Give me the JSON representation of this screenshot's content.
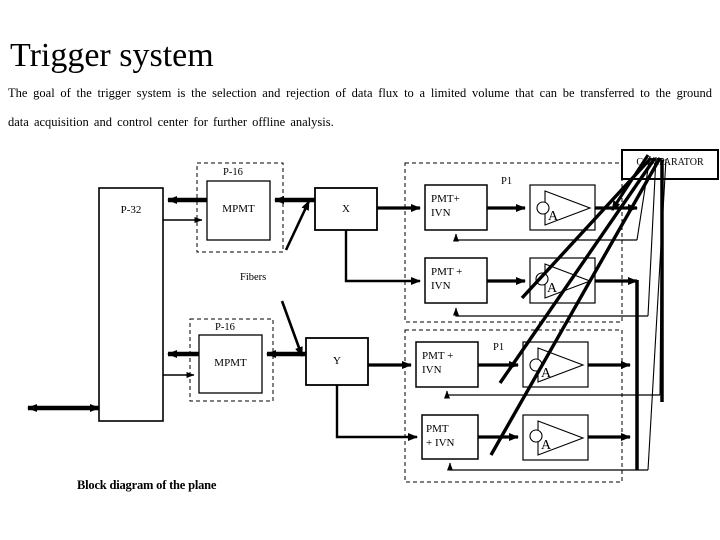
{
  "page": {
    "title": "Trigger system",
    "paragraph": "The goal of the trigger system is the selection and rejection of data flux to a limited volume that can be transferred to the ground data acquisition and control center for further offline analysis."
  },
  "diagram": {
    "caption": "Block diagram of the plane",
    "blocks": {
      "p32": "P-32",
      "mpmt_top": "MPMT",
      "mpmt_bottom": "MPMT",
      "x_block": "X",
      "y_block": "Y",
      "comparator": "COMPARATOR",
      "pmt_row1": "PMT+\nIVN",
      "pmt_row2": "PMT +\nIVN",
      "pmt_row3": "PMT +\nIVN",
      "pmt_row4": "PMT\n+ IVN",
      "amp_row1": "A",
      "amp_row2": "A",
      "amp_row3": "A",
      "amp_row4": "A"
    },
    "annotations": {
      "p16_top": "P-16",
      "p16_bottom": "P-16",
      "fibers": "Fibers",
      "p1_top": "P1",
      "p1_bottom": "P1"
    }
  },
  "colors": {
    "stroke": "#000000",
    "background": "#ffffff"
  }
}
